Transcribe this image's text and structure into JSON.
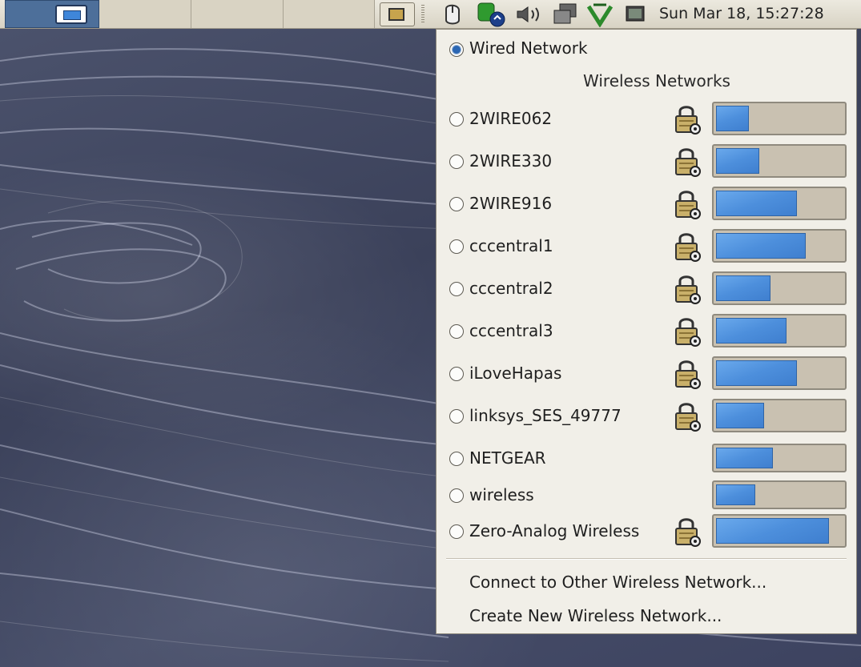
{
  "panel": {
    "clock": "Sun Mar 18, 15:27:28",
    "workspaces": [
      "ws1",
      "ws2",
      "ws3",
      "ws4"
    ],
    "tray_icons": [
      "mouse-icon",
      "update-icon",
      "volume-icon",
      "network-icon",
      "recycle-icon",
      "monitor-icon"
    ]
  },
  "menu": {
    "wired_label": "Wired Network",
    "wireless_header": "Wireless Networks",
    "networks": [
      {
        "name": "2WIRE062",
        "locked": true,
        "signal": 0.26
      },
      {
        "name": "2WIRE330",
        "locked": true,
        "signal": 0.34
      },
      {
        "name": "2WIRE916",
        "locked": true,
        "signal": 0.64
      },
      {
        "name": "cccentral1",
        "locked": true,
        "signal": 0.71
      },
      {
        "name": "cccentral2",
        "locked": true,
        "signal": 0.43
      },
      {
        "name": "cccentral3",
        "locked": true,
        "signal": 0.56
      },
      {
        "name": "iLoveHapas",
        "locked": true,
        "signal": 0.64
      },
      {
        "name": "linksys_SES_49777",
        "locked": true,
        "signal": 0.38
      },
      {
        "name": "NETGEAR",
        "locked": false,
        "signal": 0.45
      },
      {
        "name": "wireless",
        "locked": false,
        "signal": 0.31
      },
      {
        "name": "Zero-Analog Wireless",
        "locked": true,
        "signal": 0.89
      }
    ],
    "connect_other": "Connect to Other Wireless Network...",
    "create_new": "Create New Wireless Network..."
  },
  "colors": {
    "signal_fill": "#4d8fdc",
    "signal_bg": "#c9c1b1",
    "menu_bg": "#f1efe8",
    "workspace_active": "#4d6f9a"
  }
}
